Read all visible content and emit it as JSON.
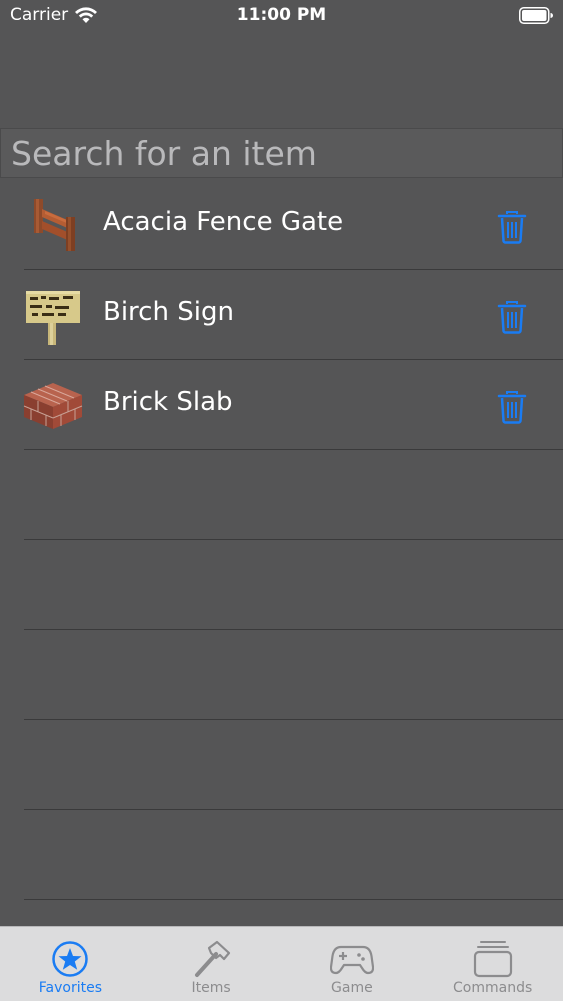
{
  "status_bar": {
    "carrier": "Carrier",
    "time": "11:00 PM"
  },
  "search": {
    "placeholder": "Search for an item",
    "value": ""
  },
  "favorites": {
    "items": [
      {
        "name": "Acacia Fence Gate",
        "icon": "acacia-fence-gate-icon"
      },
      {
        "name": "Birch Sign",
        "icon": "birch-sign-icon"
      },
      {
        "name": "Brick Slab",
        "icon": "brick-slab-icon"
      }
    ],
    "empty_rows": 5
  },
  "tab_bar": {
    "active": "favorites",
    "tabs": [
      {
        "id": "favorites",
        "label": "Favorites",
        "icon": "star-icon"
      },
      {
        "id": "items",
        "label": "Items",
        "icon": "hammer-icon"
      },
      {
        "id": "game",
        "label": "Game",
        "icon": "gamepad-icon"
      },
      {
        "id": "commands",
        "label": "Commands",
        "icon": "stack-icon"
      }
    ]
  },
  "colors": {
    "background": "#555556",
    "accent": "#1a7cf3",
    "tab_bar": "#dcdcdd",
    "inactive": "#8c8c8e"
  }
}
